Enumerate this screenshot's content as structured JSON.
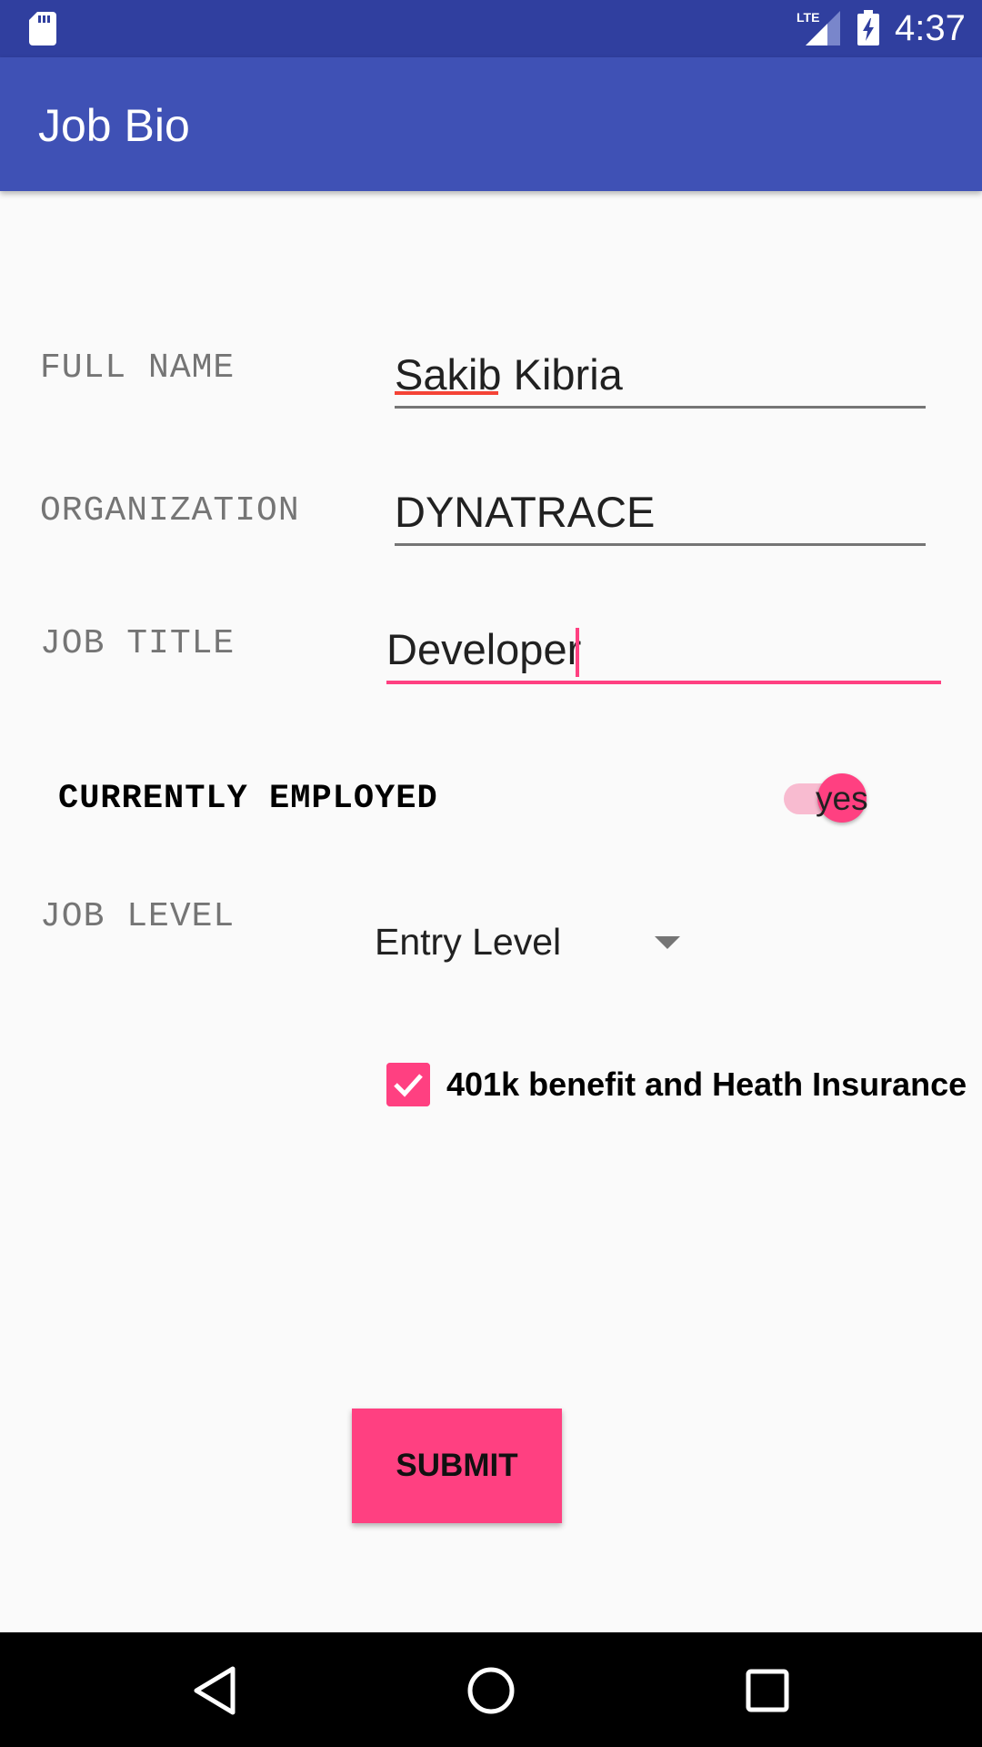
{
  "status_bar": {
    "time": "4:37",
    "network_label": "LTE",
    "icons": [
      "sd-card-icon",
      "lte-signal-icon",
      "battery-charging-icon"
    ]
  },
  "app_bar": {
    "title": "Job Bio"
  },
  "form": {
    "full_name": {
      "label": "FULL NAME",
      "value": "Sakib Kibria"
    },
    "organization": {
      "label": "ORGANIZATION",
      "value": "DYNATRACE"
    },
    "job_title": {
      "label": "JOB TITLE",
      "value": "Developer"
    },
    "currently_employed": {
      "label": "CURRENTLY EMPLOYED",
      "switch_text": "yes",
      "checked": true
    },
    "job_level": {
      "label": "JOB LEVEL",
      "selected": "Entry Level"
    },
    "benefits": {
      "label": "401k benefit and Heath Insurance",
      "checked": true
    },
    "submit_label": "SUBMIT"
  },
  "nav_bar": {
    "icons": [
      "back-icon",
      "home-icon",
      "recents-icon"
    ]
  },
  "colors": {
    "status_bar": "#303f9f",
    "app_bar": "#3f51b5",
    "accent": "#ff4081",
    "background": "#fafafa"
  }
}
